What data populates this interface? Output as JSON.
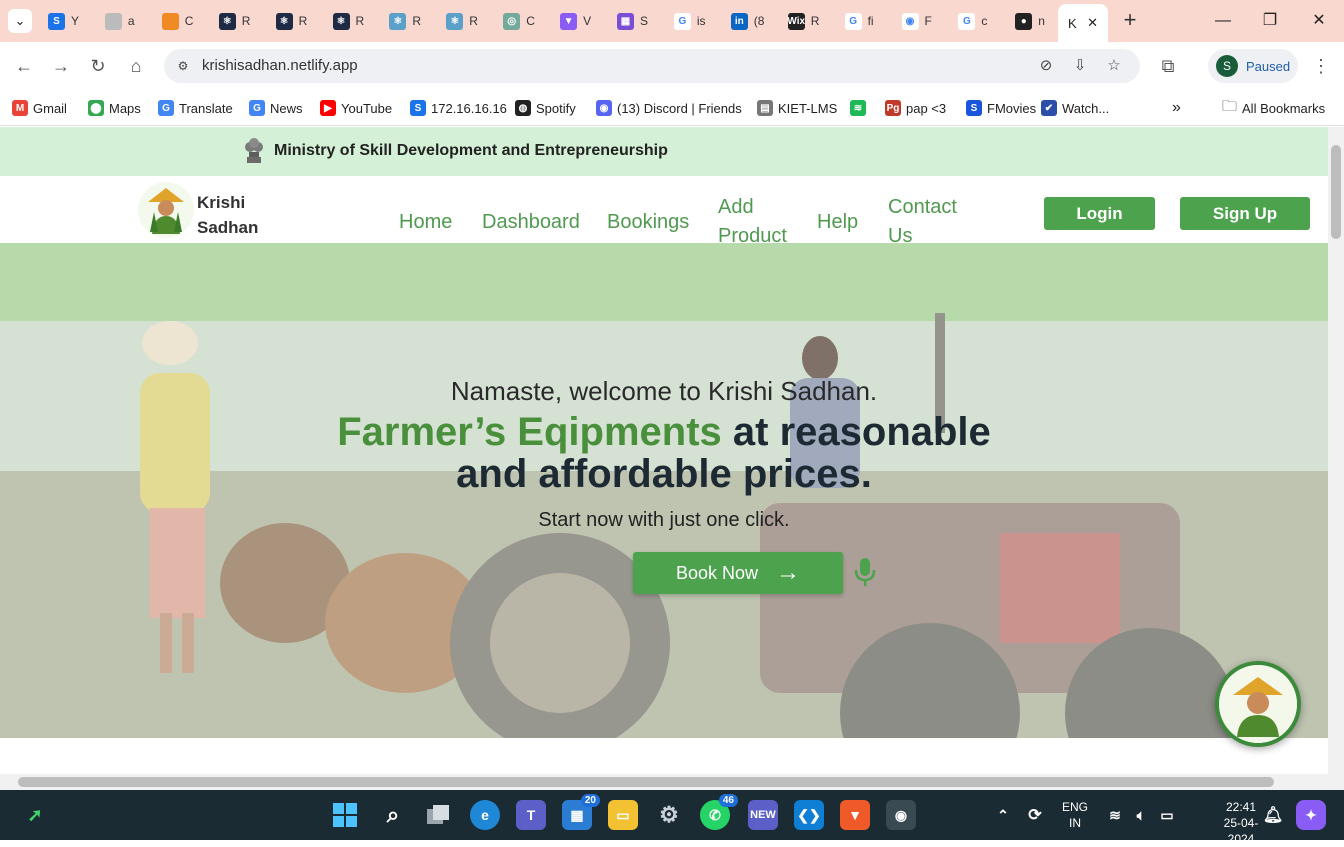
{
  "browser": {
    "tabs": [
      {
        "letter": "Y",
        "icon": "s-favicon",
        "color": "#1a73e8",
        "glyph": "S"
      },
      {
        "letter": "a",
        "icon": "globe-favicon",
        "color": "#bbbbbb",
        "glyph": ""
      },
      {
        "letter": "C",
        "icon": "claude-favicon",
        "color": "#f08a24",
        "glyph": ""
      },
      {
        "letter": "R",
        "icon": "react-favicon",
        "color": "#1f2a44",
        "glyph": "⚛"
      },
      {
        "letter": "R",
        "icon": "react-favicon",
        "color": "#1f2a44",
        "glyph": "⚛"
      },
      {
        "letter": "R",
        "icon": "react-favicon",
        "color": "#1f2a44",
        "glyph": "⚛"
      },
      {
        "letter": "R",
        "icon": "react-favicon",
        "color": "#5aa0c8",
        "glyph": "⚛"
      },
      {
        "letter": "R",
        "icon": "react-favicon",
        "color": "#5aa0c8",
        "glyph": "⚛"
      },
      {
        "letter": "C",
        "icon": "chatgpt-favicon",
        "color": "#74aa9c",
        "glyph": "◎"
      },
      {
        "letter": "V",
        "icon": "vite-favicon",
        "color": "#8a5cf6",
        "glyph": "▼"
      },
      {
        "letter": "S",
        "icon": "calendar-favicon",
        "color": "#7b4dd6",
        "glyph": "▦"
      },
      {
        "letter": "is",
        "icon": "google-favicon",
        "color": "#ffffff",
        "glyph": "G"
      },
      {
        "letter": "(8",
        "icon": "linkedin-favicon",
        "color": "#0a66c2",
        "glyph": "in"
      },
      {
        "letter": "R",
        "icon": "wix-favicon",
        "color": "#222222",
        "glyph": "Wix"
      },
      {
        "letter": "fi",
        "icon": "google-favicon",
        "color": "#ffffff",
        "glyph": "G"
      },
      {
        "letter": "F",
        "icon": "eye-favicon",
        "color": "#ffffff",
        "glyph": "◉"
      },
      {
        "letter": "c",
        "icon": "google-favicon",
        "color": "#ffffff",
        "glyph": "G"
      },
      {
        "letter": "n",
        "icon": "github-favicon",
        "color": "#222222",
        "glyph": "●"
      }
    ],
    "active_tab": {
      "letter": "K",
      "close": "✕"
    },
    "new_tab": "+",
    "address": "krishisadhan.netlify.app",
    "profile": {
      "initial": "S",
      "status": "Paused"
    },
    "bookmarks": [
      {
        "label": "Gmail",
        "icon": "gmail-icon",
        "color": "#ea4335",
        "glyph": "M"
      },
      {
        "label": "Maps",
        "icon": "maps-icon",
        "color": "#34a853",
        "glyph": "⬤"
      },
      {
        "label": "Translate",
        "icon": "translate-icon",
        "color": "#4285f4",
        "glyph": "G"
      },
      {
        "label": "News",
        "icon": "news-icon",
        "color": "#4285f4",
        "glyph": "G"
      },
      {
        "label": "YouTube",
        "icon": "youtube-icon",
        "color": "#ff0000",
        "glyph": "▶"
      },
      {
        "label": "172.16.16.16",
        "icon": "s-icon",
        "color": "#1a73e8",
        "glyph": "S"
      },
      {
        "label": "Spotify",
        "icon": "globe-icon",
        "color": "#222222",
        "glyph": "◍"
      },
      {
        "label": "(13) Discord | Friends",
        "icon": "discord-icon",
        "color": "#5865f2",
        "glyph": "◉"
      },
      {
        "label": "KIET-LMS",
        "icon": "lms-icon",
        "color": "#777777",
        "glyph": "▤"
      },
      {
        "label": "",
        "icon": "spotify-icon",
        "color": "#1db954",
        "glyph": "≋"
      },
      {
        "label": "pap <3",
        "icon": "pg-icon",
        "color": "#c0392b",
        "glyph": "Pg"
      },
      {
        "label": "FMovies",
        "icon": "s-blue-icon",
        "color": "#1a56db",
        "glyph": "S"
      },
      {
        "label": "Watch...",
        "icon": "check-icon",
        "color": "#2b4fa8",
        "glyph": "✔"
      }
    ],
    "more": "»",
    "all_bookmarks": "All Bookmarks"
  },
  "site": {
    "ministry": "Ministry of Skill Development and Entrepreneurship",
    "brand_line1": "Krishi",
    "brand_line2": "Sadhan",
    "nav": {
      "home": "Home",
      "dashboard": "Dashboard",
      "bookings": "Bookings",
      "add_product_1": "Add",
      "add_product_2": "Product",
      "help": "Help",
      "contact_1": "Contact",
      "contact_2": "Us"
    },
    "login": "Login",
    "signup": "Sign Up",
    "hero": {
      "greeting": "Namaste, welcome to Krishi Sadhan.",
      "title_accent": "Farmer’s Eqipments",
      "title_rest_1": " at reasonable",
      "title_rest_2": "and affordable prices.",
      "tagline": "Start now with just one click.",
      "cta": "Book Now",
      "cta_arrow": "→"
    }
  },
  "taskbar": {
    "badges": {
      "store": "20",
      "whatsapp": "46"
    },
    "lang_1": "ENG",
    "lang_2": "IN",
    "time": "22:41",
    "date": "25-04-2024"
  },
  "colors": {
    "accent_green": "#4da24d",
    "strip_green": "#d4f0d6",
    "tab_strip": "#f9d8cf",
    "taskbar": "#1b2b33"
  }
}
